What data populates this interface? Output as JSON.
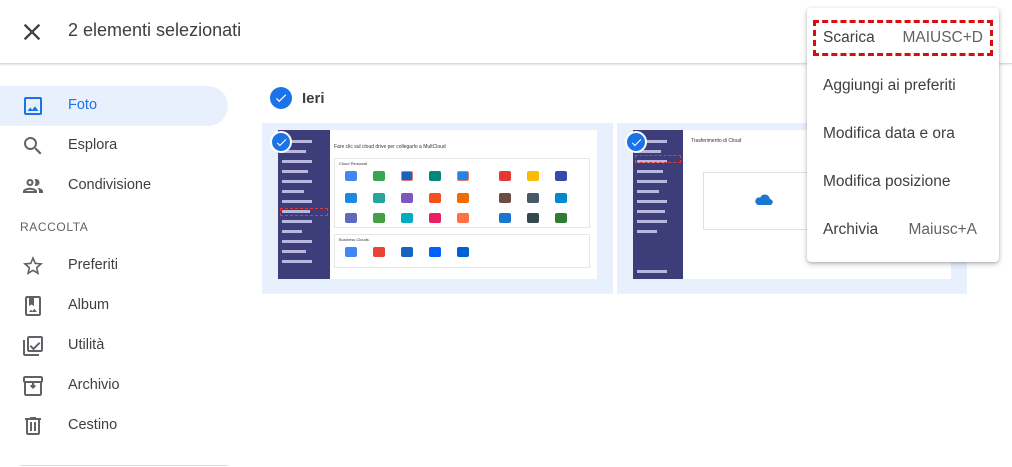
{
  "topbar": {
    "title": "2 elementi selezionati"
  },
  "sidebar": {
    "items": [
      {
        "label": "Foto",
        "icon": "photo-icon"
      },
      {
        "label": "Esplora",
        "icon": "search-icon"
      },
      {
        "label": "Condivisione",
        "icon": "people-icon"
      }
    ],
    "section_label": "RACCOLTA",
    "collection": [
      {
        "label": "Preferiti",
        "icon": "star-icon"
      },
      {
        "label": "Album",
        "icon": "album-icon"
      },
      {
        "label": "Utilità",
        "icon": "utility-icon"
      },
      {
        "label": "Archivio",
        "icon": "archive-icon"
      },
      {
        "label": "Cestino",
        "icon": "trash-icon"
      }
    ]
  },
  "main": {
    "date_group": "Ieri",
    "thumb1": {
      "heading": "Fare clic sul cloud drive per collegarlo a MultCloud",
      "section1": "Cloud Personali",
      "section2": "Business Clouds"
    },
    "thumb2": {
      "heading": "Trasferimento di Cloud"
    }
  },
  "menu": {
    "items": [
      {
        "label": "Scarica",
        "shortcut": "MAIUSC+D"
      },
      {
        "label": "Aggiungi ai preferiti",
        "shortcut": ""
      },
      {
        "label": "Modifica data e ora",
        "shortcut": ""
      },
      {
        "label": "Modifica posizione",
        "shortcut": ""
      },
      {
        "label": "Archivia",
        "shortcut": "Maiusc+A"
      }
    ]
  },
  "colors": {
    "accent": "#1a73e8",
    "selected_bg": "#e8f0fe",
    "highlight": "#d80d0d"
  }
}
